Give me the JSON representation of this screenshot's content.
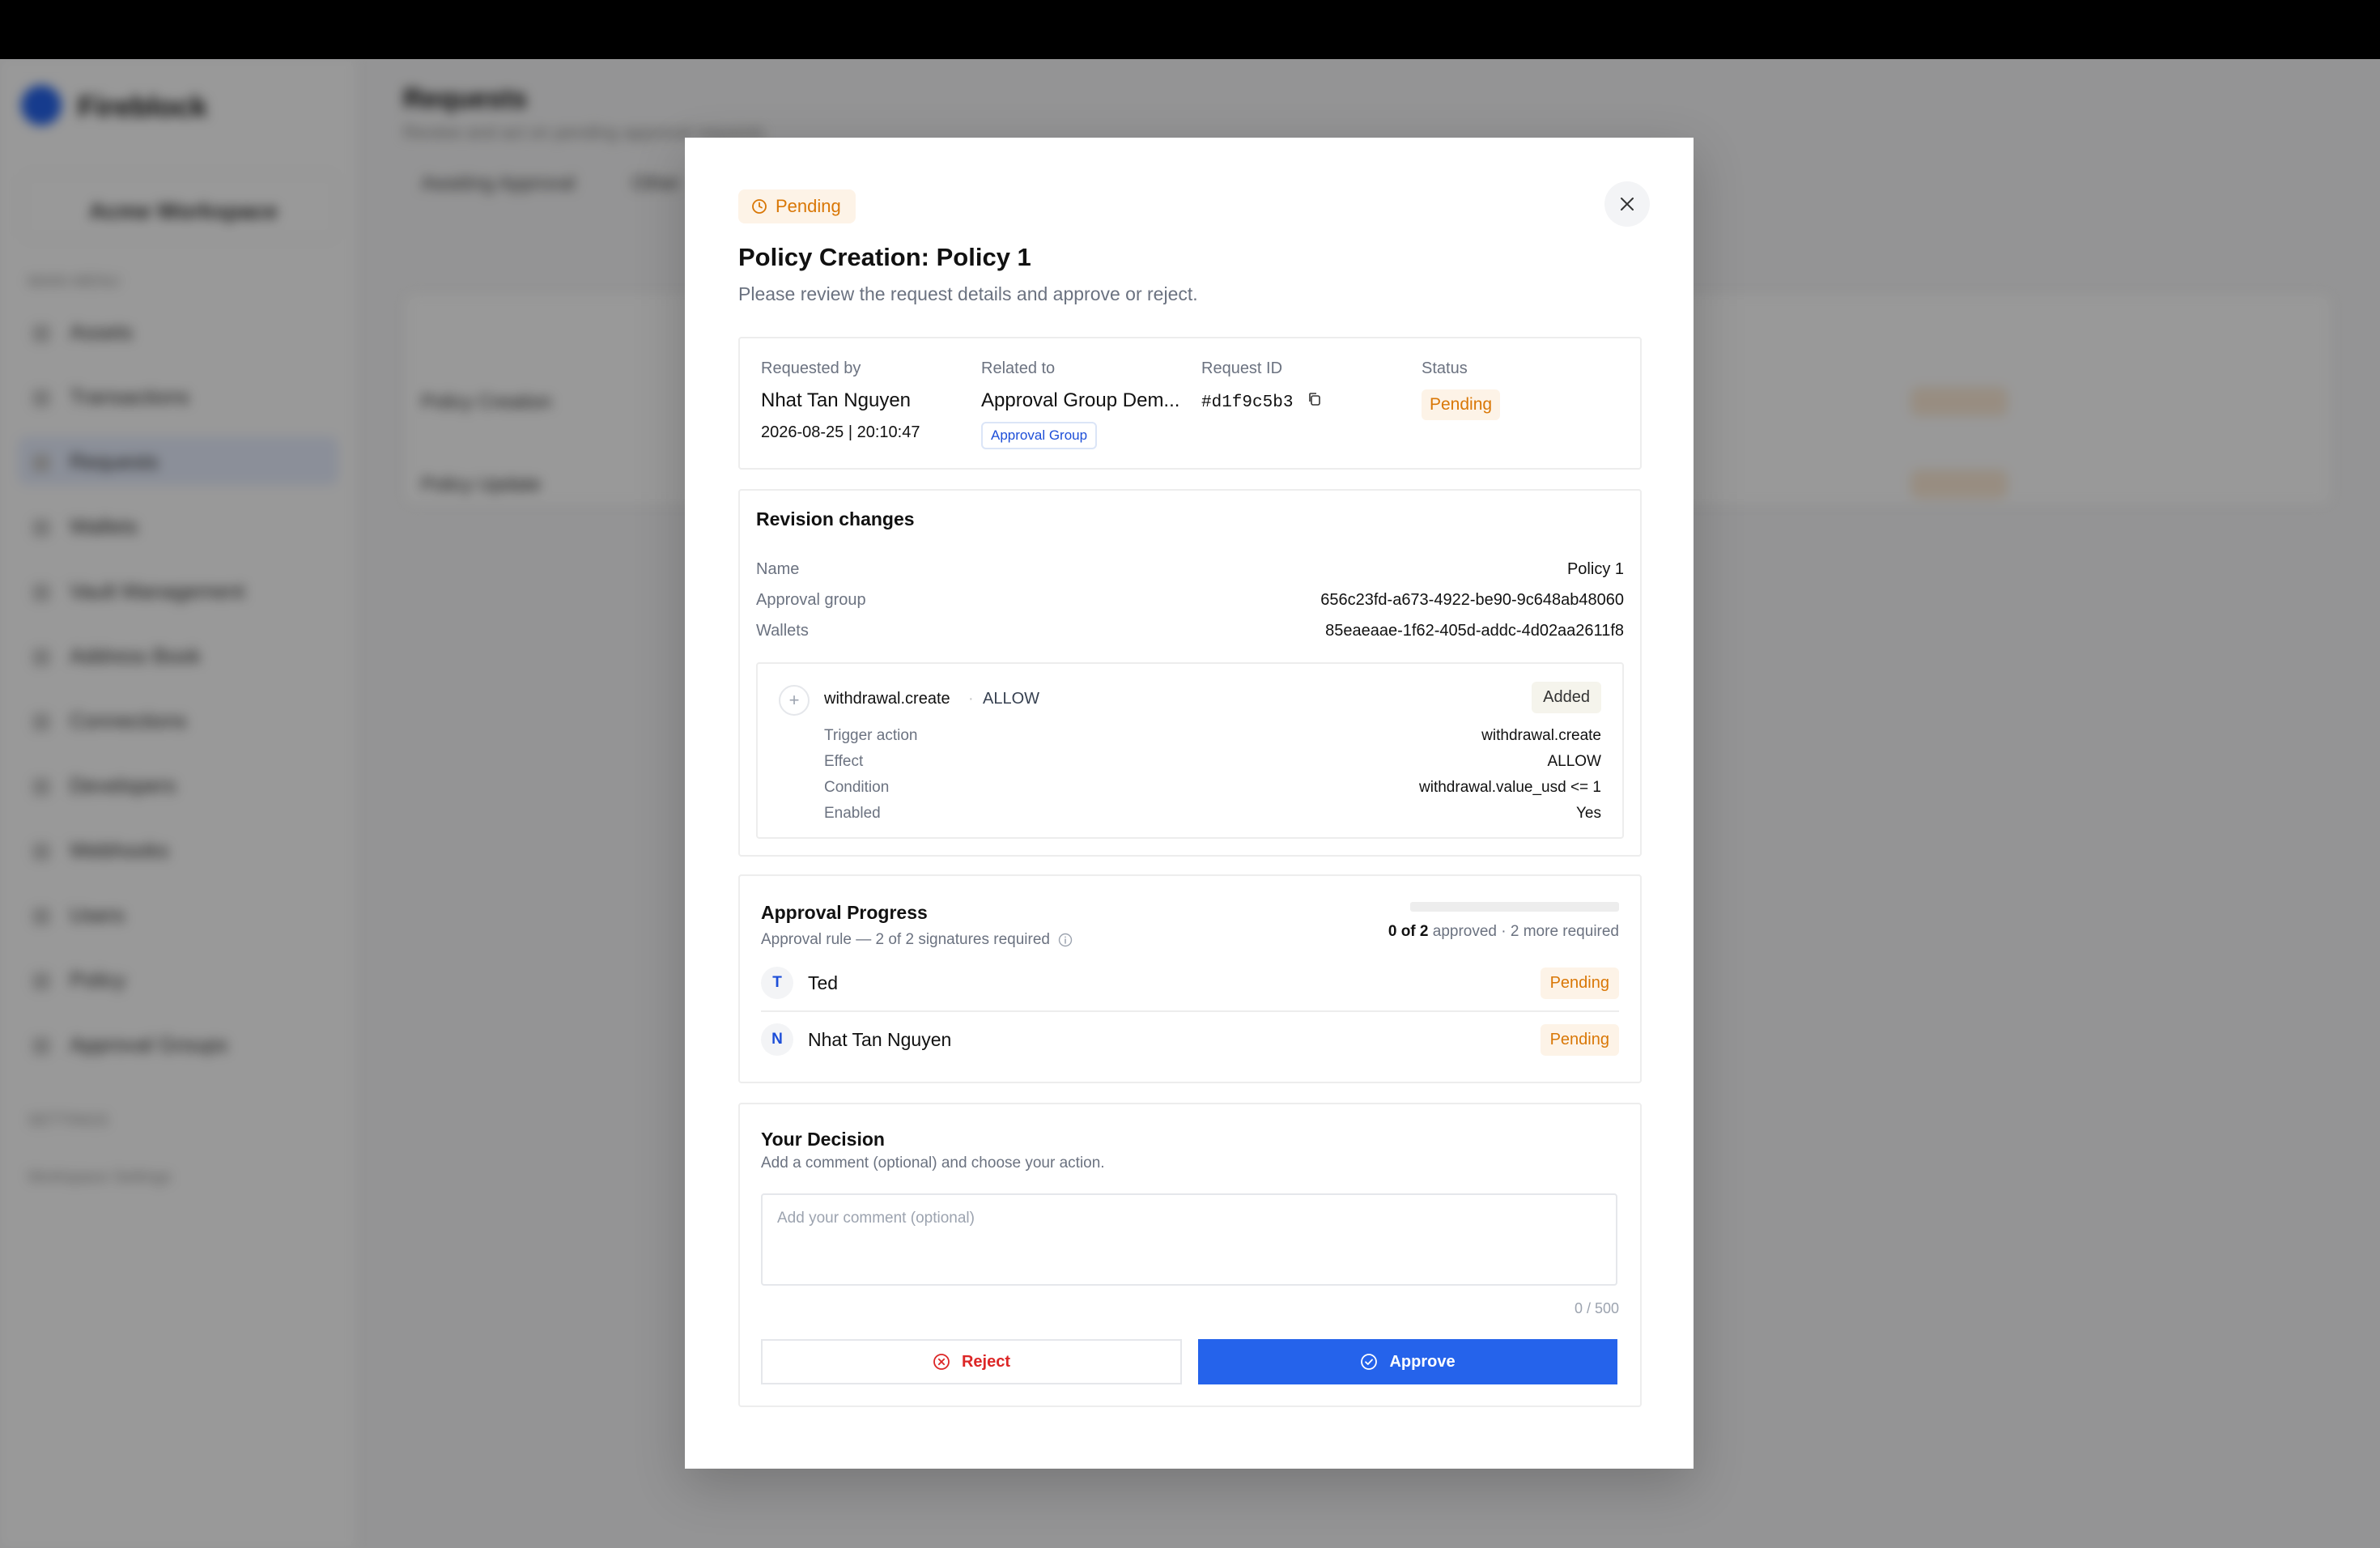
{
  "background": {
    "app_name": "Fireblock",
    "workspace": "Acme Workspace",
    "nav_section_1": "MAIN MENU",
    "nav_items": [
      "Assets",
      "Transactions",
      "Requests",
      "Wallets",
      "Vault Management",
      "Address Book",
      "Connections",
      "Developers",
      "Webhooks",
      "Users",
      "Policy",
      "Approval Groups"
    ],
    "nav_section_2": "SETTINGS",
    "nav_section_3": "Workspace Settings",
    "page_title": "Requests",
    "page_subtitle": "Review and act on pending approval requests",
    "tabs": [
      "Awaiting Approval",
      "Other"
    ],
    "rows": [
      "Policy Creation",
      "Policy Update"
    ]
  },
  "modal": {
    "status_badge": "Pending",
    "title": "Policy Creation: Policy 1",
    "subtitle": "Please review the request details and approve or reject.",
    "info": {
      "requested_by_label": "Requested by",
      "requested_by": "Nhat Tan Nguyen",
      "requested_at": "2026-08-25 | 20:10:47",
      "related_label": "Related to",
      "related_value": "Approval Group Dem...",
      "related_tag": "Approval Group",
      "request_id_label": "Request ID",
      "request_id": "#d1f9c5b3",
      "status_label": "Status",
      "status_value": "Pending"
    },
    "revision": {
      "title": "Revision changes",
      "fields": [
        {
          "label": "Name",
          "value": "Policy 1"
        },
        {
          "label": "Approval group",
          "value": "656c23fd-a673-4922-be90-9c648ab48060"
        },
        {
          "label": "Wallets",
          "value": "85eaeaae-1f62-405d-addc-4d02aa2611f8"
        }
      ],
      "rule": {
        "name": "withdrawal.create",
        "separator": "·",
        "effect": "ALLOW",
        "badge": "Added",
        "details": [
          {
            "label": "Trigger action",
            "value": "withdrawal.create"
          },
          {
            "label": "Effect",
            "value": "ALLOW"
          },
          {
            "label": "Condition",
            "value": "withdrawal.value_usd <= 1"
          },
          {
            "label": "Enabled",
            "value": "Yes"
          }
        ]
      }
    },
    "progress": {
      "title": "Approval Progress",
      "rule_text": "Approval rule — 2 of 2 signatures required",
      "approved_count": "0 of 2",
      "approved_suffix": " approved · 2 more required",
      "fraction": 0,
      "approvers": [
        {
          "initial": "T",
          "name": "Ted",
          "status": "Pending"
        },
        {
          "initial": "N",
          "name": "Nhat Tan Nguyen",
          "status": "Pending"
        }
      ]
    },
    "decision": {
      "title": "Your Decision",
      "subtitle": "Add a comment (optional) and choose your action.",
      "comment_placeholder": "Add your comment (optional)",
      "comment_value": "",
      "counter": "0 / 500",
      "reject_label": "Reject",
      "approve_label": "Approve"
    }
  },
  "colors": {
    "accent": "#2563eb",
    "pending": "#d97706",
    "pending_bg": "#fdf3e7",
    "reject": "#dc2626"
  },
  "icons": {
    "status": "clock-icon",
    "close": "close-icon",
    "copy": "copy-icon",
    "rule": "plus-icon",
    "info": "info-icon",
    "reject": "x-circle-icon",
    "approve": "check-circle-icon"
  }
}
